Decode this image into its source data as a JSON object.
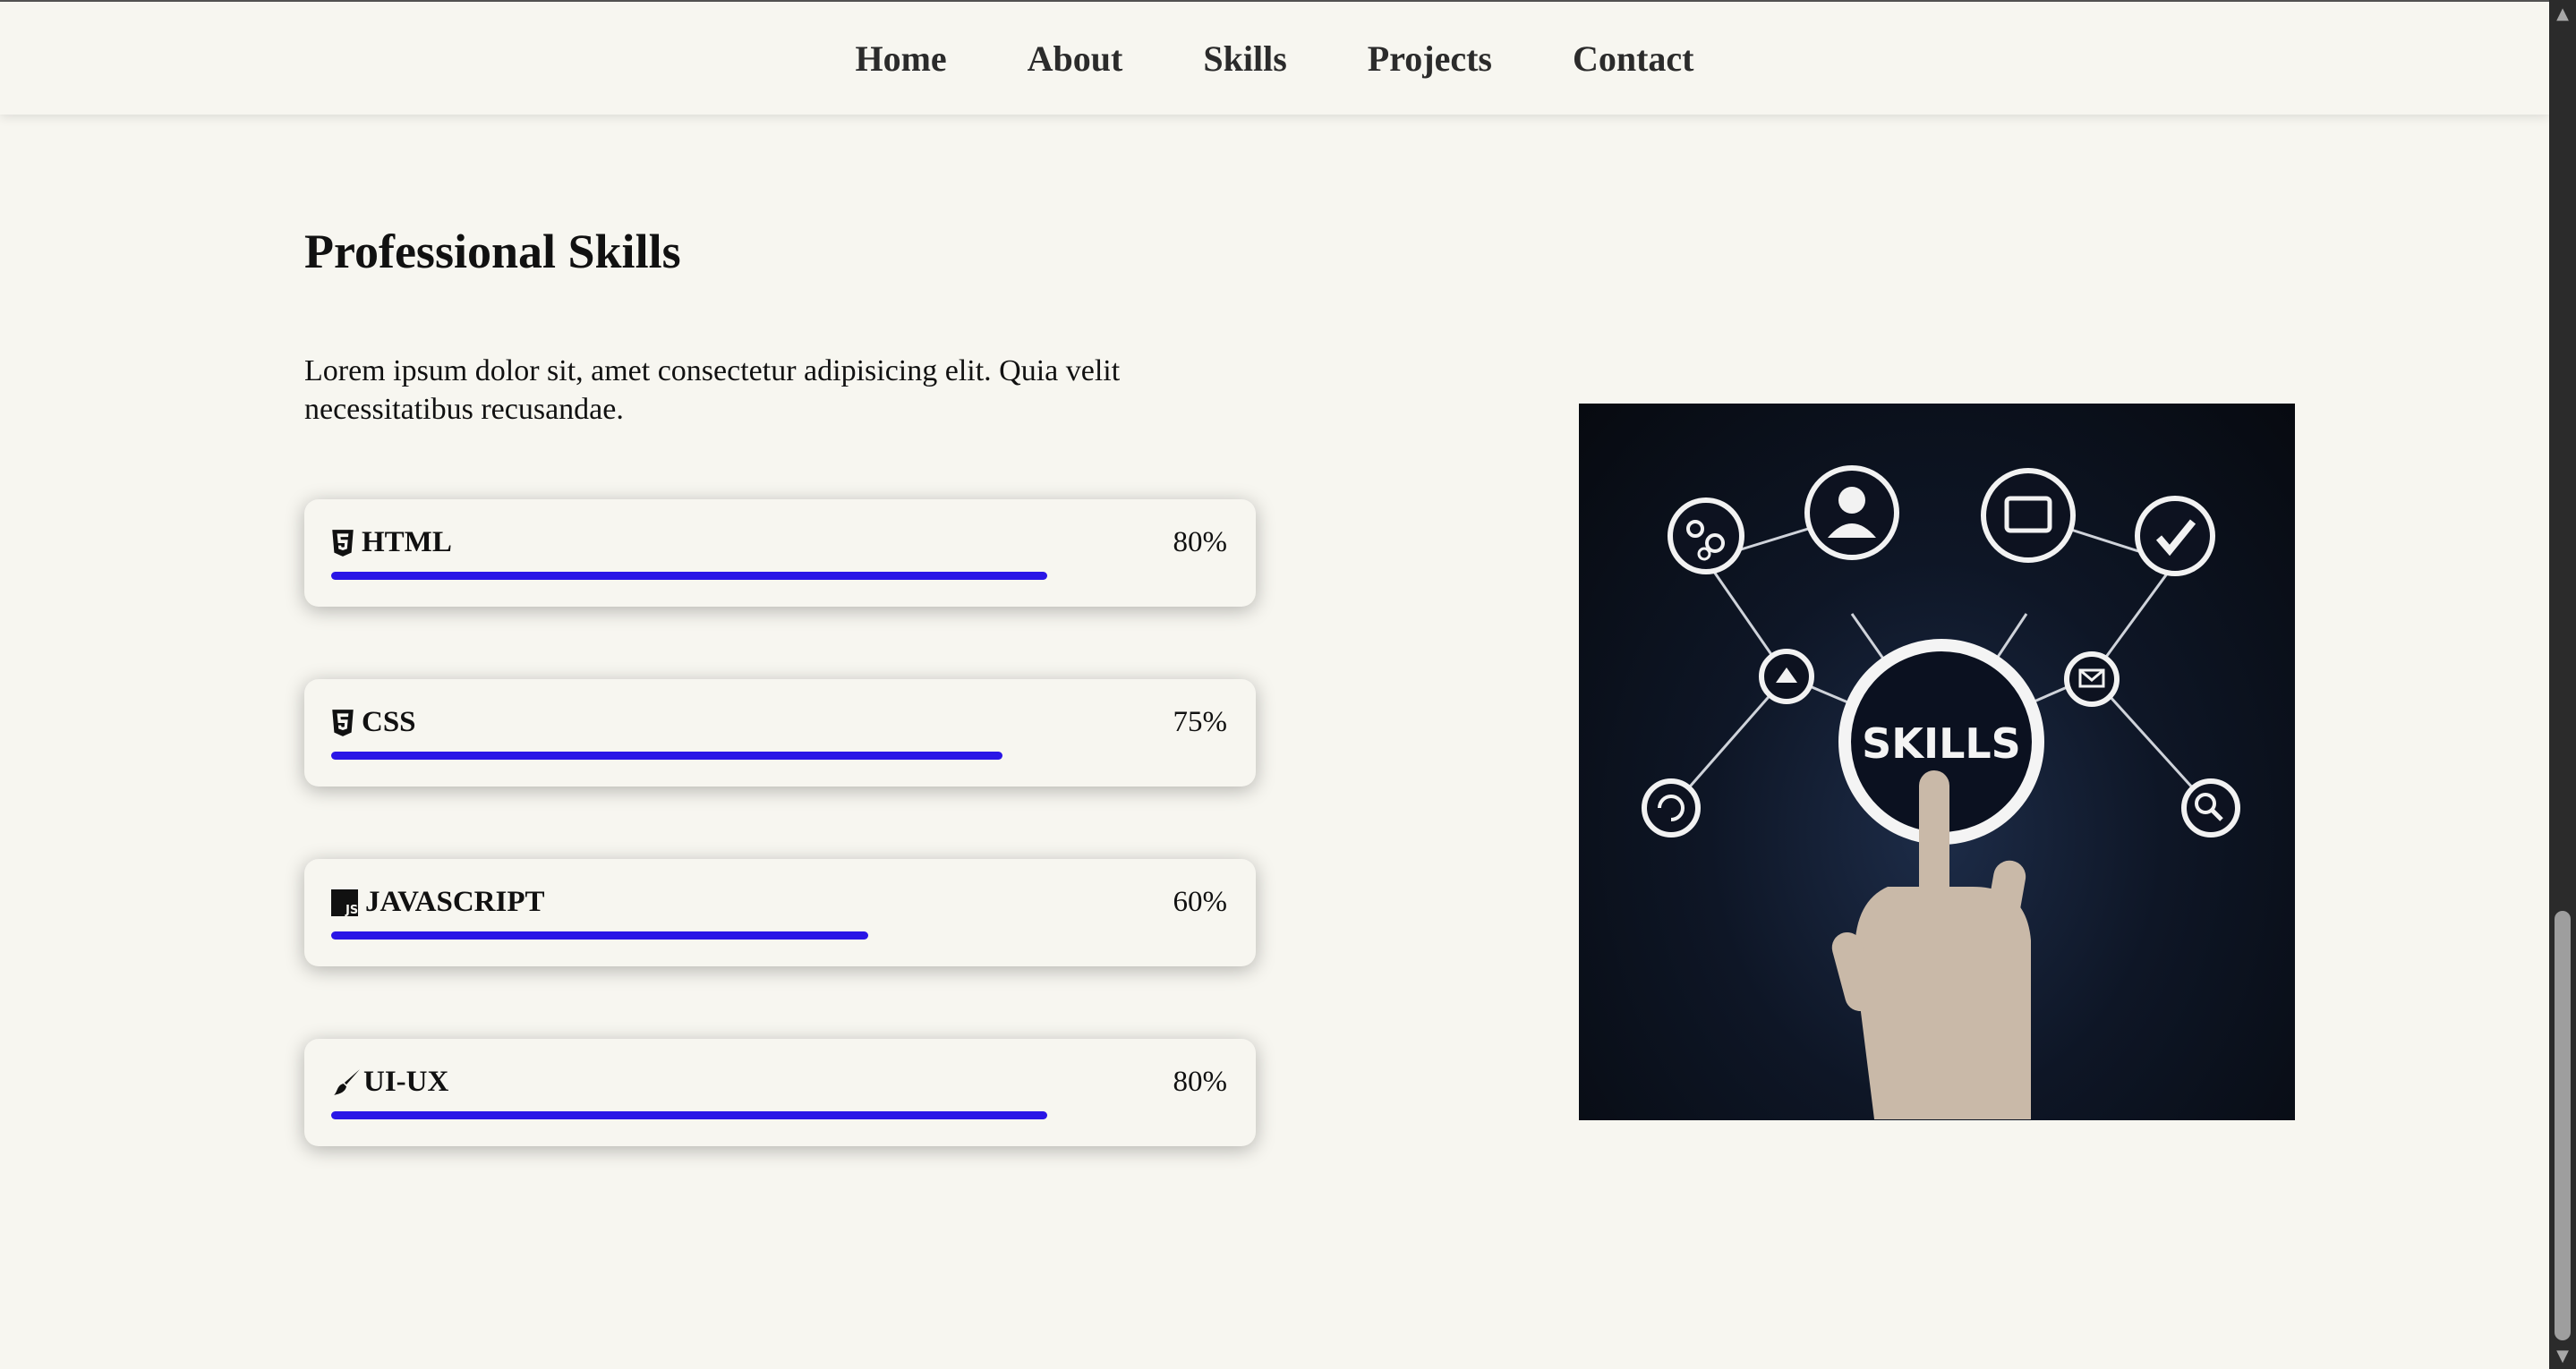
{
  "nav": {
    "items": [
      "Home",
      "About",
      "Skills",
      "Projects",
      "Contact"
    ]
  },
  "section": {
    "title": "Professional Skills",
    "description": "Lorem ipsum dolor sit, amet consectetur adipisicing elit. Quia velit necessitatibus recusandae."
  },
  "skills": [
    {
      "name": "HTML",
      "percent_label": "80%",
      "value": 80,
      "icon": "html5-icon"
    },
    {
      "name": "CSS",
      "percent_label": "75%",
      "value": 75,
      "icon": "css3-icon"
    },
    {
      "name": "JAVASCRIPT",
      "percent_label": "60%",
      "value": 60,
      "icon": "js-icon"
    },
    {
      "name": "UI-UX",
      "percent_label": "80%",
      "value": 80,
      "icon": "brush-icon"
    }
  ],
  "image": {
    "center_label": "SKILLS"
  },
  "colors": {
    "background": "#f7f6f0",
    "progress_bar": "#2a16e6",
    "text": "#111111"
  }
}
